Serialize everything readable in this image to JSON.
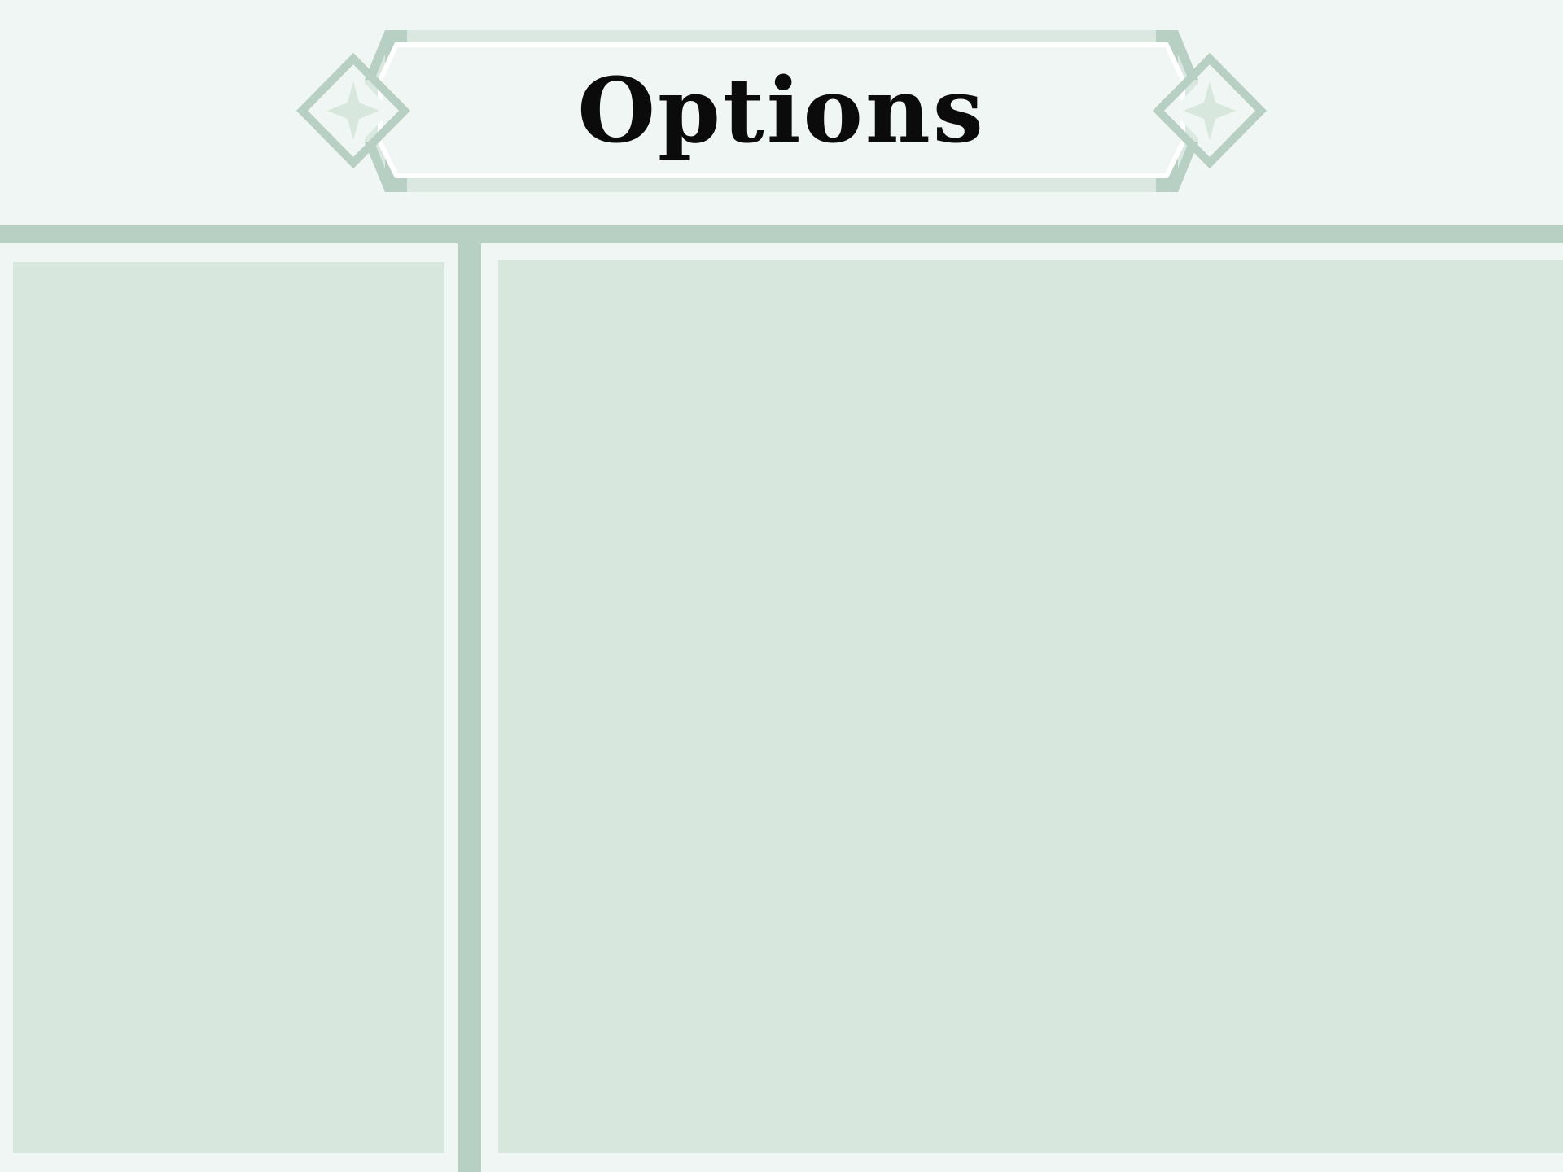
{
  "screen": {
    "title": "Options"
  },
  "colors": {
    "background": "#eff6f3",
    "panel": "#d7e7dd",
    "frame": "#b8cfc4",
    "banner_fill": "#dbe8e1",
    "title_text": "#0b0b0b"
  },
  "icons": {
    "left_ornament": "diamond-star-icon",
    "right_ornament": "diamond-star-icon"
  }
}
